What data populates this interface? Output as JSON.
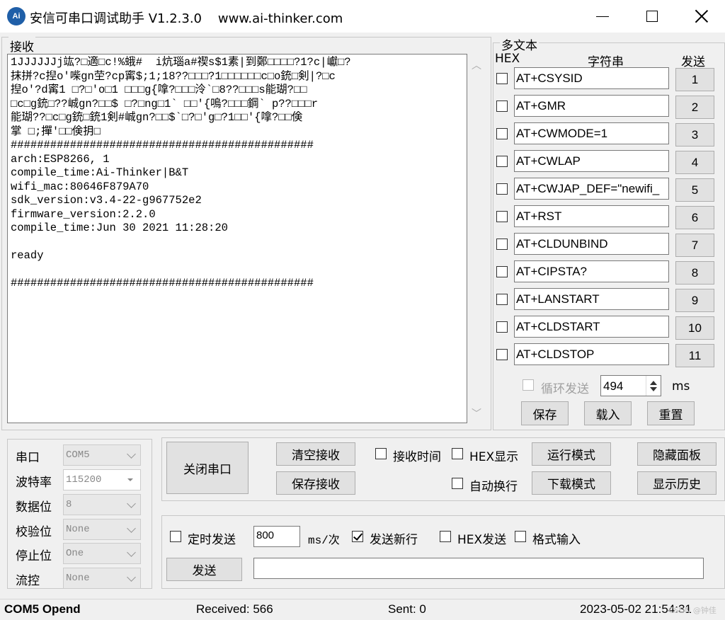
{
  "window": {
    "title": "安信可串口调试助手 V1.2.3.0    www.ai-thinker.com",
    "icon_text": "Ai"
  },
  "receive": {
    "label": "接收",
    "lines": [
      "1JJJJJJj竑?□適□c!%蛾#  i炕瑙a#禊s$1素|到鄭□□□□?1?c|巘□?",
      "抹拼?c揑o'喍gn茔?cp寗$;1;18??□□□?1□□□□□□c□o銃□剣|?□c",
      "揑o'?d寗1 □?□'o□1 □□□g{嗱?□□□泠`□8??□□□s能瑚?□□",
      "□c□g銃□??峸gn?□□$ □?□ng□1` □□'{嗚?□□□鋼` p??□□□r",
      "能瑚??□c□g銃□銃1剣#峸gn?□□$`□?□'g□?1□□'{嗱?□□倹",
      "掌 □;撣'□□倹抈□",
      "##############################################",
      "arch:ESP8266, 1",
      "compile_time:Ai-Thinker|B&T",
      "wifi_mac:80646F879A70",
      "sdk_version:v3.4-22-g967752e2",
      "firmware_version:2.2.0",
      "compile_time:Jun 30 2021 11:28:20",
      "",
      "ready",
      "",
      "##############################################"
    ]
  },
  "multi": {
    "label": "多文本",
    "hex_header": "HEX",
    "string_header": "字符串",
    "send_header": "发送",
    "rows": [
      {
        "text": "AT+CSYSID",
        "btn": "1"
      },
      {
        "text": "AT+GMR",
        "btn": "2"
      },
      {
        "text": "AT+CWMODE=1",
        "btn": "3"
      },
      {
        "text": "AT+CWLAP",
        "btn": "4"
      },
      {
        "text": "AT+CWJAP_DEF=\"newifi_",
        "btn": "5"
      },
      {
        "text": "AT+RST",
        "btn": "6"
      },
      {
        "text": "AT+CLDUNBIND",
        "btn": "7"
      },
      {
        "text": "AT+CIPSTA?",
        "btn": "8"
      },
      {
        "text": "AT+LANSTART",
        "btn": "9"
      },
      {
        "text": "AT+CLDSTART",
        "btn": "10"
      },
      {
        "text": "AT+CLDSTOP",
        "btn": "11"
      }
    ],
    "loop_label": "循环发送",
    "loop_value": "494",
    "ms_label": "ms",
    "save_label": "保存",
    "load_label": "载入",
    "reset_label": "重置"
  },
  "port": {
    "com_label": "串口",
    "com_value": "COM5",
    "baud_label": "波特率",
    "baud_value": "115200",
    "databits_label": "数据位",
    "databits_value": "8",
    "parity_label": "校验位",
    "parity_value": "None",
    "stopbits_label": "停止位",
    "stopbits_value": "One",
    "flow_label": "流控",
    "flow_value": "None"
  },
  "controls": {
    "close_port": "关闭串口",
    "clear_recv": "清空接收",
    "save_recv": "保存接收",
    "recv_time": "接收时间",
    "hex_display": "HEX显示",
    "auto_wrap": "自动换行",
    "run_mode": "运行模式",
    "download_mode": "下载模式",
    "hide_panel": "隐藏面板",
    "show_history": "显示历史"
  },
  "send": {
    "timed_send": "定时发送",
    "interval_value": "800",
    "interval_unit": "ms/次",
    "send_newline": "发送新行",
    "hex_send": "HEX发送",
    "format_input": "格式输入",
    "send_button": "发送",
    "send_text": ""
  },
  "status": {
    "port_status": "COM5 Opend",
    "received": "Received: 566",
    "sent": "Sent: 0",
    "datetime": "2023-05-02 21:54:31",
    "watermark": "CSDN @钟佳"
  }
}
